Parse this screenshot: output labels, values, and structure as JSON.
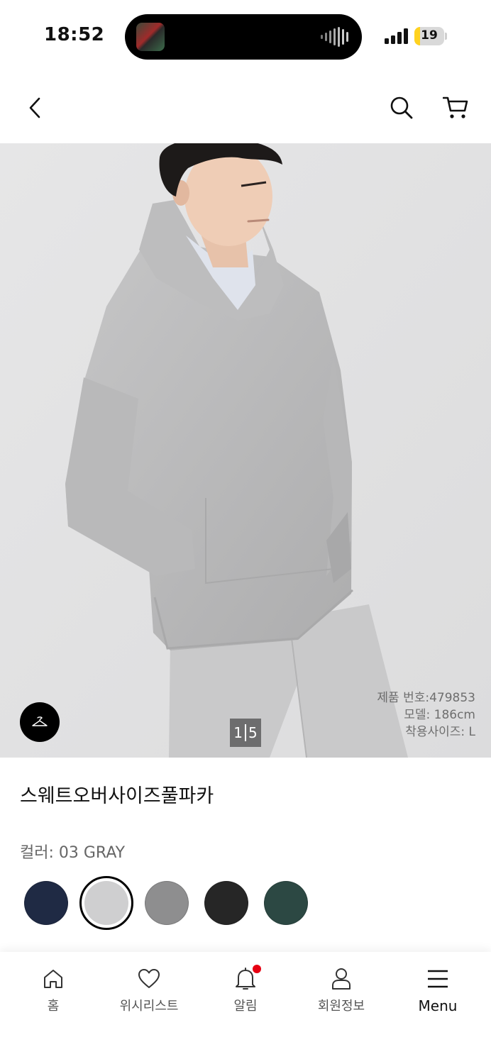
{
  "status_bar": {
    "time": "18:52",
    "battery_level": "19",
    "battery_fraction": 0.19
  },
  "header": {
    "back_icon": "chevron-left-icon",
    "search_icon": "search-icon",
    "cart_icon": "cart-icon"
  },
  "gallery": {
    "current_page": "1",
    "total_pages": "5",
    "product_number": "제품 번호:479853",
    "model_height": "모델: 186cm",
    "worn_size": "착용사이즈: L",
    "try_on_icon": "hanger-icon"
  },
  "product": {
    "name": "스웨트오버사이즈풀파카",
    "color_label": "컬러: 03 GRAY",
    "swatches": [
      {
        "name": "navy",
        "color": "#1f2a44",
        "selected": false
      },
      {
        "name": "light-gray",
        "color": "#cfcfd0",
        "selected": true
      },
      {
        "name": "gray",
        "color": "#8e8e8f",
        "selected": false
      },
      {
        "name": "black",
        "color": "#262626",
        "selected": false
      },
      {
        "name": "dark-green",
        "color": "#2c4843",
        "selected": false
      }
    ]
  },
  "bottom_nav": {
    "items": [
      {
        "label": "홈",
        "icon": "home-icon"
      },
      {
        "label": "위시리스트",
        "icon": "heart-icon"
      },
      {
        "label": "알림",
        "icon": "bell-icon",
        "badge": true
      },
      {
        "label": "회원정보",
        "icon": "user-icon"
      },
      {
        "label": "Menu",
        "icon": "menu-icon"
      }
    ]
  },
  "colors": {
    "badge": "#e60012",
    "battery_fill": "#ffd21f",
    "hero_bg": "#e3e3e4"
  }
}
